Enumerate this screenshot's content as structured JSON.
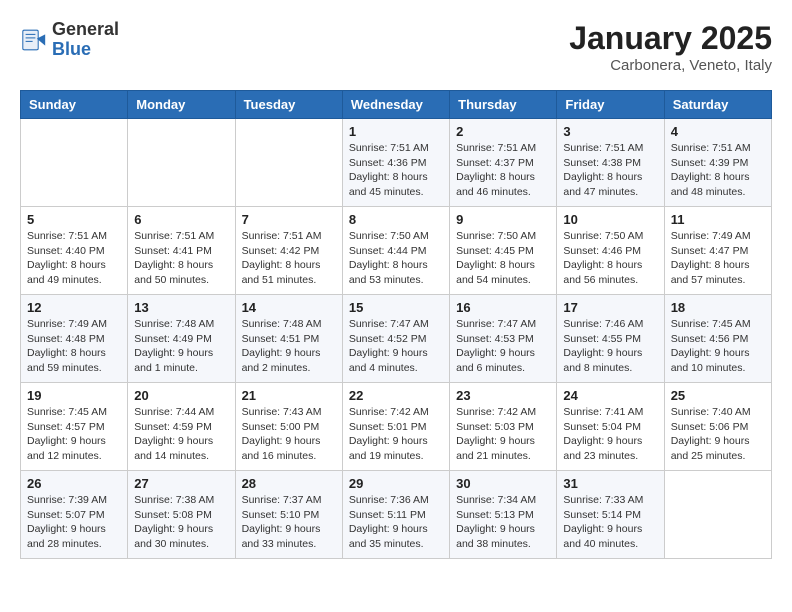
{
  "header": {
    "logo_general": "General",
    "logo_blue": "Blue",
    "month_title": "January 2025",
    "location": "Carbonera, Veneto, Italy"
  },
  "weekdays": [
    "Sunday",
    "Monday",
    "Tuesday",
    "Wednesday",
    "Thursday",
    "Friday",
    "Saturday"
  ],
  "weeks": [
    [
      {
        "day": "",
        "info": ""
      },
      {
        "day": "",
        "info": ""
      },
      {
        "day": "",
        "info": ""
      },
      {
        "day": "1",
        "info": "Sunrise: 7:51 AM\nSunset: 4:36 PM\nDaylight: 8 hours\nand 45 minutes."
      },
      {
        "day": "2",
        "info": "Sunrise: 7:51 AM\nSunset: 4:37 PM\nDaylight: 8 hours\nand 46 minutes."
      },
      {
        "day": "3",
        "info": "Sunrise: 7:51 AM\nSunset: 4:38 PM\nDaylight: 8 hours\nand 47 minutes."
      },
      {
        "day": "4",
        "info": "Sunrise: 7:51 AM\nSunset: 4:39 PM\nDaylight: 8 hours\nand 48 minutes."
      }
    ],
    [
      {
        "day": "5",
        "info": "Sunrise: 7:51 AM\nSunset: 4:40 PM\nDaylight: 8 hours\nand 49 minutes."
      },
      {
        "day": "6",
        "info": "Sunrise: 7:51 AM\nSunset: 4:41 PM\nDaylight: 8 hours\nand 50 minutes."
      },
      {
        "day": "7",
        "info": "Sunrise: 7:51 AM\nSunset: 4:42 PM\nDaylight: 8 hours\nand 51 minutes."
      },
      {
        "day": "8",
        "info": "Sunrise: 7:50 AM\nSunset: 4:44 PM\nDaylight: 8 hours\nand 53 minutes."
      },
      {
        "day": "9",
        "info": "Sunrise: 7:50 AM\nSunset: 4:45 PM\nDaylight: 8 hours\nand 54 minutes."
      },
      {
        "day": "10",
        "info": "Sunrise: 7:50 AM\nSunset: 4:46 PM\nDaylight: 8 hours\nand 56 minutes."
      },
      {
        "day": "11",
        "info": "Sunrise: 7:49 AM\nSunset: 4:47 PM\nDaylight: 8 hours\nand 57 minutes."
      }
    ],
    [
      {
        "day": "12",
        "info": "Sunrise: 7:49 AM\nSunset: 4:48 PM\nDaylight: 8 hours\nand 59 minutes."
      },
      {
        "day": "13",
        "info": "Sunrise: 7:48 AM\nSunset: 4:49 PM\nDaylight: 9 hours\nand 1 minute."
      },
      {
        "day": "14",
        "info": "Sunrise: 7:48 AM\nSunset: 4:51 PM\nDaylight: 9 hours\nand 2 minutes."
      },
      {
        "day": "15",
        "info": "Sunrise: 7:47 AM\nSunset: 4:52 PM\nDaylight: 9 hours\nand 4 minutes."
      },
      {
        "day": "16",
        "info": "Sunrise: 7:47 AM\nSunset: 4:53 PM\nDaylight: 9 hours\nand 6 minutes."
      },
      {
        "day": "17",
        "info": "Sunrise: 7:46 AM\nSunset: 4:55 PM\nDaylight: 9 hours\nand 8 minutes."
      },
      {
        "day": "18",
        "info": "Sunrise: 7:45 AM\nSunset: 4:56 PM\nDaylight: 9 hours\nand 10 minutes."
      }
    ],
    [
      {
        "day": "19",
        "info": "Sunrise: 7:45 AM\nSunset: 4:57 PM\nDaylight: 9 hours\nand 12 minutes."
      },
      {
        "day": "20",
        "info": "Sunrise: 7:44 AM\nSunset: 4:59 PM\nDaylight: 9 hours\nand 14 minutes."
      },
      {
        "day": "21",
        "info": "Sunrise: 7:43 AM\nSunset: 5:00 PM\nDaylight: 9 hours\nand 16 minutes."
      },
      {
        "day": "22",
        "info": "Sunrise: 7:42 AM\nSunset: 5:01 PM\nDaylight: 9 hours\nand 19 minutes."
      },
      {
        "day": "23",
        "info": "Sunrise: 7:42 AM\nSunset: 5:03 PM\nDaylight: 9 hours\nand 21 minutes."
      },
      {
        "day": "24",
        "info": "Sunrise: 7:41 AM\nSunset: 5:04 PM\nDaylight: 9 hours\nand 23 minutes."
      },
      {
        "day": "25",
        "info": "Sunrise: 7:40 AM\nSunset: 5:06 PM\nDaylight: 9 hours\nand 25 minutes."
      }
    ],
    [
      {
        "day": "26",
        "info": "Sunrise: 7:39 AM\nSunset: 5:07 PM\nDaylight: 9 hours\nand 28 minutes."
      },
      {
        "day": "27",
        "info": "Sunrise: 7:38 AM\nSunset: 5:08 PM\nDaylight: 9 hours\nand 30 minutes."
      },
      {
        "day": "28",
        "info": "Sunrise: 7:37 AM\nSunset: 5:10 PM\nDaylight: 9 hours\nand 33 minutes."
      },
      {
        "day": "29",
        "info": "Sunrise: 7:36 AM\nSunset: 5:11 PM\nDaylight: 9 hours\nand 35 minutes."
      },
      {
        "day": "30",
        "info": "Sunrise: 7:34 AM\nSunset: 5:13 PM\nDaylight: 9 hours\nand 38 minutes."
      },
      {
        "day": "31",
        "info": "Sunrise: 7:33 AM\nSunset: 5:14 PM\nDaylight: 9 hours\nand 40 minutes."
      },
      {
        "day": "",
        "info": ""
      }
    ]
  ]
}
